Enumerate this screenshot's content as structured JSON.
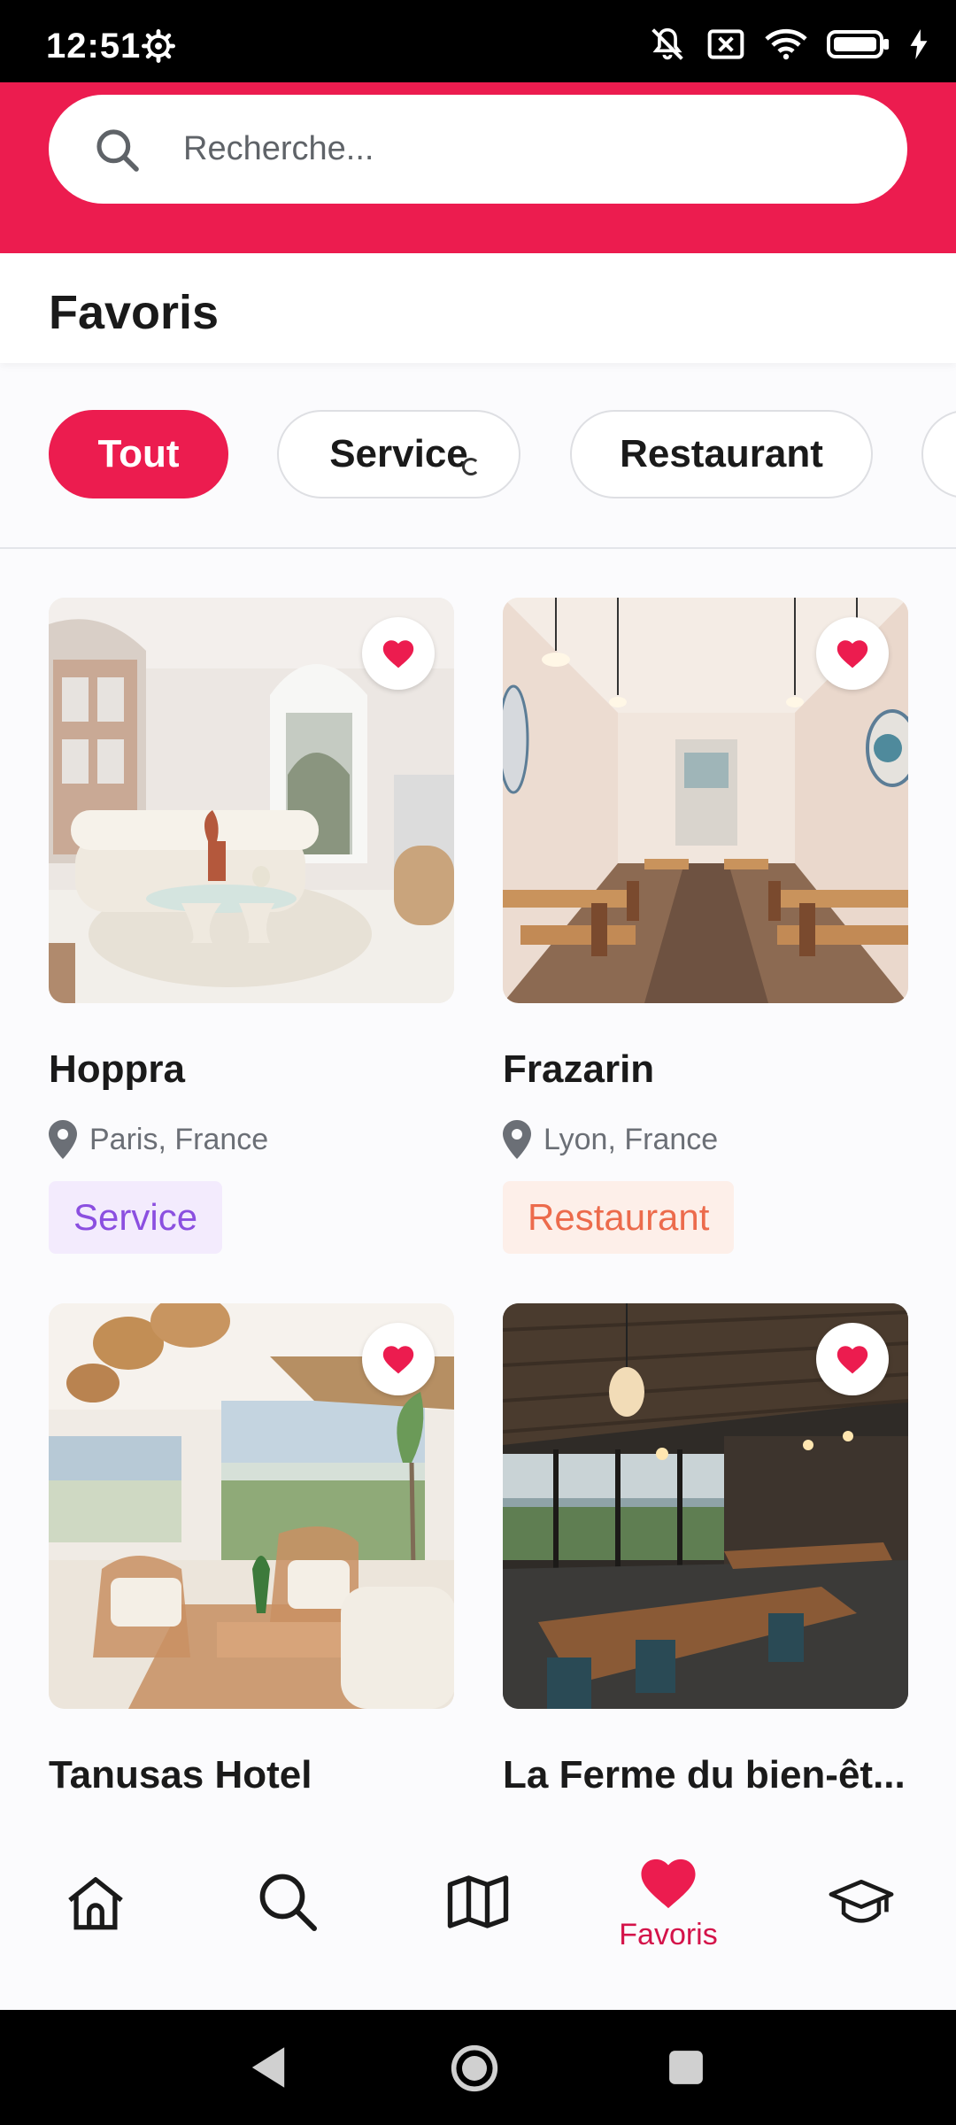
{
  "status_bar": {
    "time": "12:51",
    "icons": [
      "settings-icon",
      "mute-icon",
      "sim-error-icon",
      "wifi-icon",
      "battery-icon",
      "charging-icon"
    ]
  },
  "search": {
    "placeholder": "Recherche...",
    "value": ""
  },
  "page": {
    "title": "Favoris"
  },
  "filters": {
    "items": [
      {
        "label": "Tout",
        "active": true
      },
      {
        "label": "Service",
        "active": false
      },
      {
        "label": "Restaurant",
        "active": false
      },
      {
        "label": "",
        "active": false
      }
    ]
  },
  "cards": [
    {
      "name": "Hoppra",
      "location": "Paris, France",
      "tag": "Service",
      "favorite": true,
      "image": "living-room-photo"
    },
    {
      "name": "Frazarin",
      "location": "Lyon, France",
      "tag": "Restaurant",
      "favorite": true,
      "image": "restaurant-interior-photo"
    },
    {
      "name": "Tanusas Hotel",
      "location": "",
      "tag": "",
      "favorite": true,
      "image": "hotel-lounge-photo"
    },
    {
      "name": "La Ferme du bien-êt...",
      "location": "",
      "tag": "",
      "favorite": true,
      "image": "restaurant-terrace-photo"
    }
  ],
  "bottom_nav": {
    "items": [
      {
        "icon": "home-icon",
        "label": ""
      },
      {
        "icon": "search-icon",
        "label": ""
      },
      {
        "icon": "map-icon",
        "label": ""
      },
      {
        "icon": "heart-icon",
        "label": "Favoris",
        "active": true
      },
      {
        "icon": "graduation-cap-icon",
        "label": ""
      }
    ]
  },
  "colors": {
    "accent": "#ec1c4f",
    "service_tag_bg": "#f3ebfd",
    "service_tag_text": "#8b4fe0",
    "restaurant_tag_bg": "#fdefe9",
    "restaurant_tag_text": "#ec6b4c"
  }
}
